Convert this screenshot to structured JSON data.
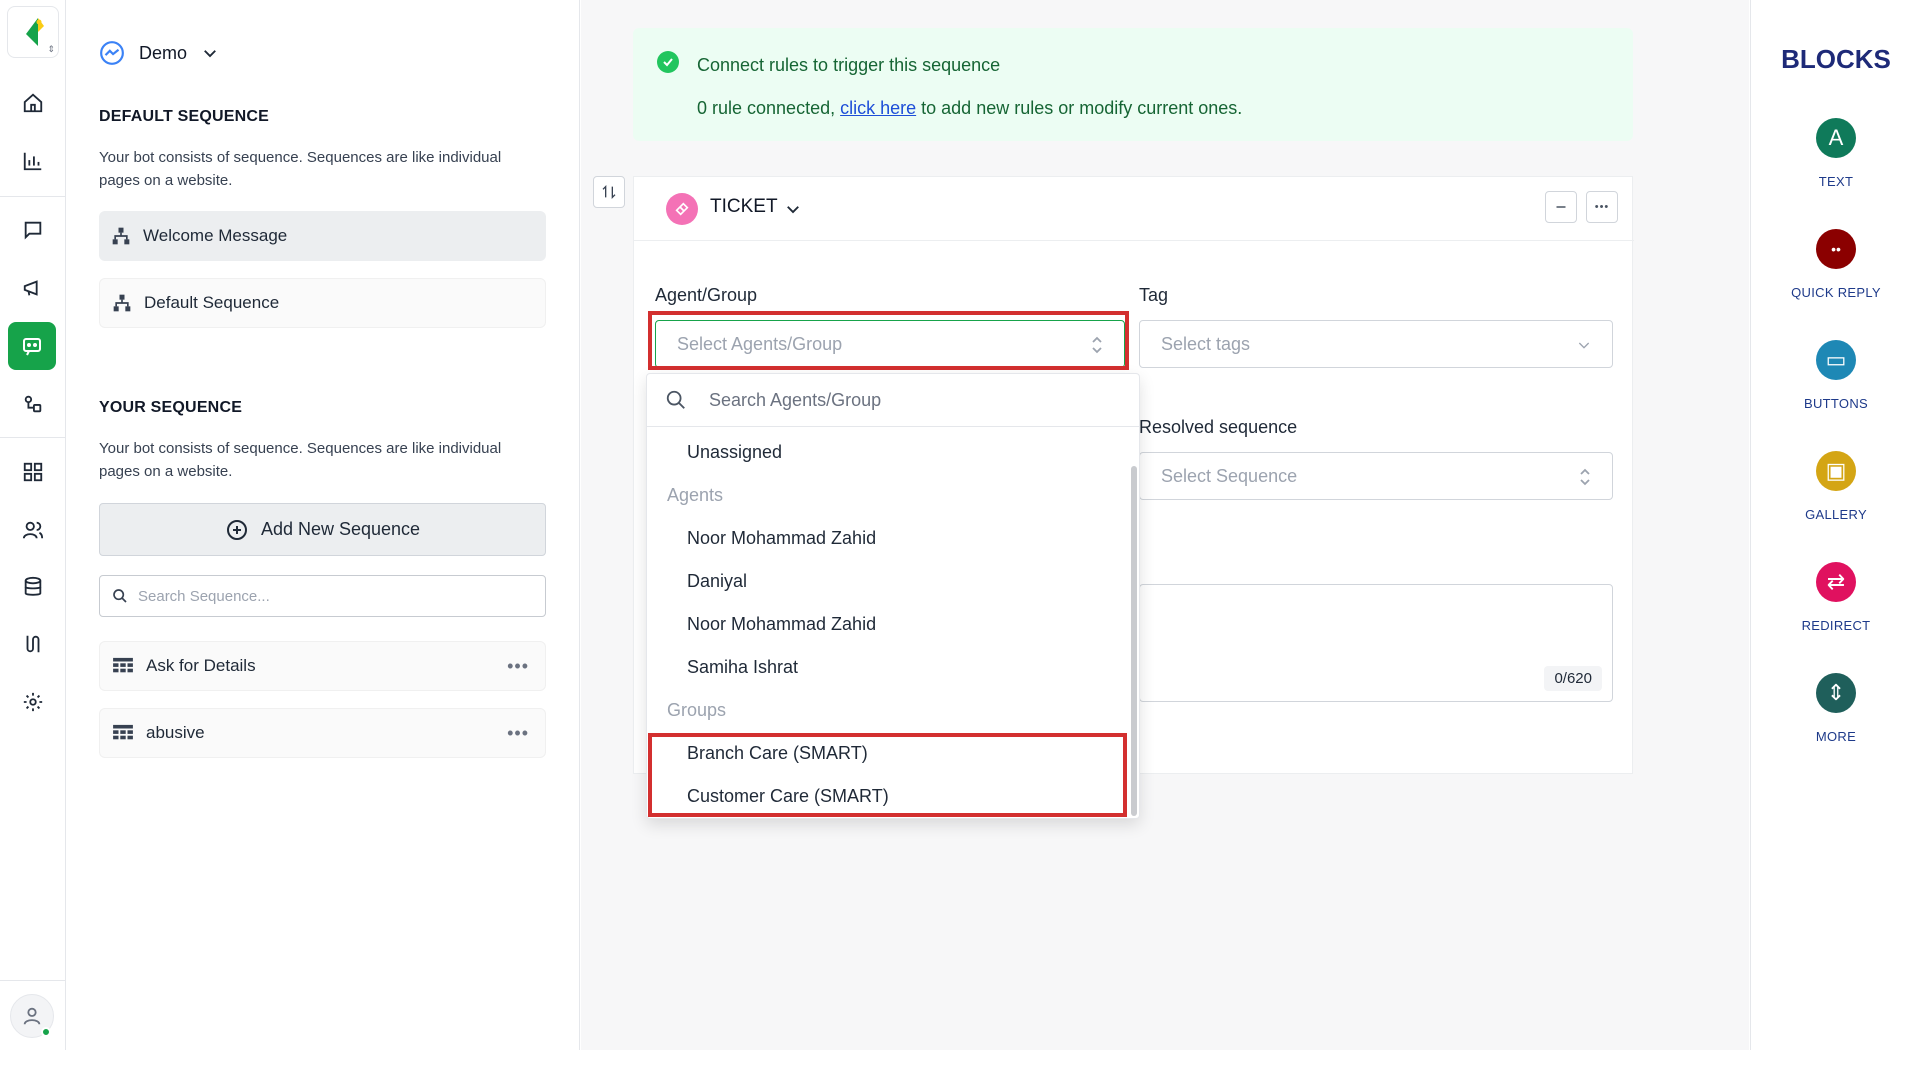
{
  "sequence_panel": {
    "bot_name": "Demo",
    "default_title": "DEFAULT SEQUENCE",
    "default_desc": "Your bot consists of sequence. Sequences are like individual pages on a website.",
    "default_items": [
      "Welcome Message",
      "Default Sequence"
    ],
    "your_title": "YOUR SEQUENCE",
    "your_desc": "Your bot consists of sequence. Sequences are like individual pages on a website.",
    "add_button": "Add New Sequence",
    "search_placeholder": "Search Sequence...",
    "your_items": [
      "Ask for Details",
      "abusive"
    ]
  },
  "rules_banner": {
    "title": "Connect rules to trigger this sequence",
    "sub_prefix": "0 rule connected, ",
    "link": "click here",
    "sub_suffix": " to add new rules or modify current ones."
  },
  "ticket": {
    "header": "TICKET",
    "agent_label": "Agent/Group",
    "agent_placeholder": "Select Agents/Group",
    "tag_label": "Tag",
    "tag_placeholder": "Select tags",
    "resolved_label": "Resolved sequence",
    "resolved_placeholder": "Select Sequence",
    "counter": "0/620"
  },
  "dropdown": {
    "search_placeholder": "Search Agents/Group",
    "unassigned": "Unassigned",
    "agents_group": "Agents",
    "agents": [
      "Noor Mohammad Zahid",
      "Daniyal",
      "Noor Mohammad Zahid",
      "Samiha Ishrat"
    ],
    "groups_group": "Groups",
    "groups": [
      "Branch Care (SMART)",
      "Customer Care (SMART)"
    ]
  },
  "blocks": {
    "title": "BLOCKS",
    "items": [
      {
        "label": "TEXT",
        "color": "#0f7a5a",
        "glyph": "A",
        "icon": "text-icon"
      },
      {
        "label": "QUICK REPLY",
        "color": "#8b0000",
        "glyph": "••",
        "icon": "quick-reply-icon"
      },
      {
        "label": "BUTTONS",
        "color": "#1e88b5",
        "glyph": "▭",
        "icon": "buttons-icon"
      },
      {
        "label": "GALLERY",
        "color": "#d4a514",
        "glyph": "▣",
        "icon": "gallery-icon"
      },
      {
        "label": "REDIRECT",
        "color": "#e0115f",
        "glyph": "⇄",
        "icon": "redirect-icon"
      },
      {
        "label": "MORE",
        "color": "#1f5f5b",
        "glyph": "⇕",
        "icon": "more-icon"
      }
    ]
  },
  "colors": {
    "accent_green": "#16a34a",
    "highlight_red": "#d32f2f",
    "ticket_pink": "#f472b6"
  }
}
